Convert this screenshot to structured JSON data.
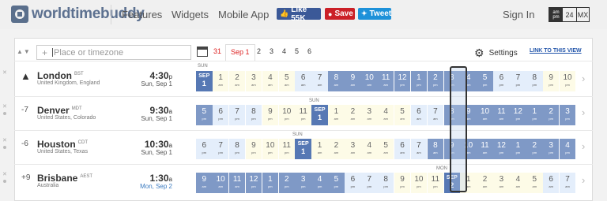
{
  "header": {
    "brand": "worldtimebuddy",
    "nav": [
      "Features",
      "Widgets",
      "Mobile App"
    ],
    "social": {
      "like": "Like 55K",
      "save": "Save",
      "tweet": "Tweet"
    },
    "signin": "Sign In",
    "format": {
      "ampm_top": "am",
      "ampm_bottom": "pm",
      "h24": "24",
      "mx": "MX"
    }
  },
  "toolbar": {
    "search_placeholder": "Place or timezone",
    "date_tabs": [
      "31",
      "Sep 1",
      "2",
      "3",
      "4",
      "5",
      "6"
    ],
    "settings": "Settings",
    "link": "LINK TO THIS VIEW"
  },
  "rows": [
    {
      "offset": "",
      "city": "London",
      "abbr": "BST",
      "country": "United Kingdom, England",
      "time": "4:30",
      "ap": "p",
      "date": "Sun, Sep 1",
      "date_blue": false,
      "day_label": "SUN",
      "home": true
    },
    {
      "offset": "-7",
      "city": "Denver",
      "abbr": "MDT",
      "country": "United States, Colorado",
      "time": "9:30",
      "ap": "a",
      "date": "Sun, Sep 1",
      "date_blue": false,
      "day_label": "SUN",
      "home": false
    },
    {
      "offset": "-6",
      "city": "Houston",
      "abbr": "CDT",
      "country": "United States, Texas",
      "time": "10:30",
      "ap": "a",
      "date": "Sun, Sep 1",
      "date_blue": false,
      "day_label": "SUN",
      "home": false
    },
    {
      "offset": "+9",
      "city": "Brisbane",
      "abbr": "AEST",
      "country": "Australia",
      "time": "1:30",
      "ap": "a",
      "date": "Mon, Sep 2",
      "date_blue": true,
      "day_label": "MON",
      "home": false
    }
  ],
  "strips": [
    {
      "start": 0,
      "daystart": 0,
      "daylabel": [
        "SEP",
        "1"
      ]
    },
    {
      "start": 17,
      "daystart": 7,
      "daylabel": [
        "SEP",
        "1"
      ]
    },
    {
      "start": 18,
      "daystart": 6,
      "daylabel": [
        "SEP",
        "1"
      ]
    },
    {
      "start": 9,
      "daystart": 15,
      "daylabel": [
        "SEP",
        "2"
      ]
    }
  ],
  "colors": {
    "dark": "#7f99c6",
    "mid": "#e4eefb",
    "light": "#fdfbe7",
    "daycell": "#5678b4"
  }
}
